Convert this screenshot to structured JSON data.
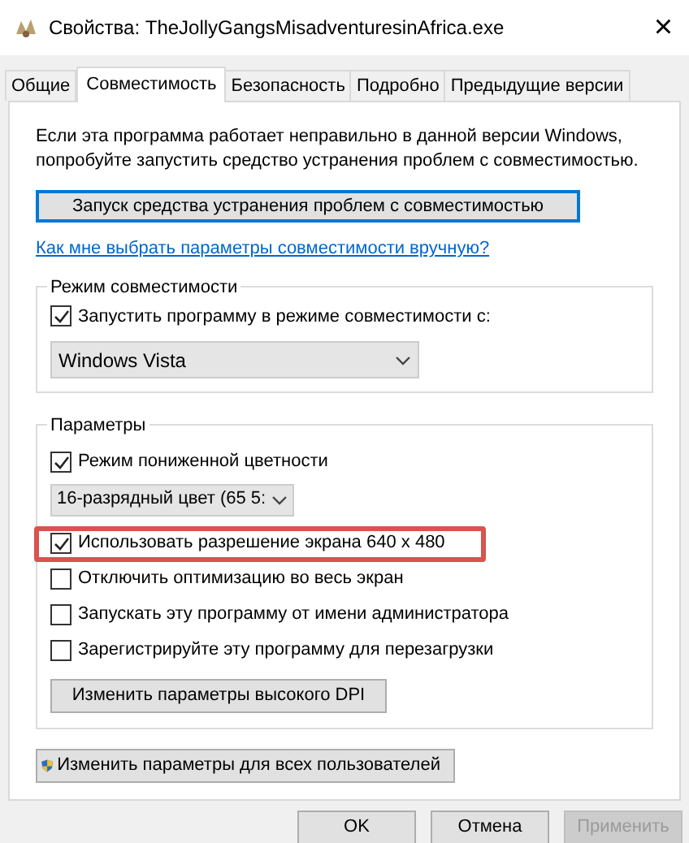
{
  "window": {
    "title": "Свойства: TheJollyGangsMisadventuresinAfrica.exe",
    "close": "×"
  },
  "tabs": [
    {
      "label": "Общие",
      "selected": false
    },
    {
      "label": "Совместимость",
      "selected": true
    },
    {
      "label": "Безопасность",
      "selected": false
    },
    {
      "label": "Подробно",
      "selected": false
    },
    {
      "label": "Предыдущие версии",
      "selected": false
    }
  ],
  "intro": "Если эта программа работает неправильно в данной версии Windows, попробуйте запустить средство устранения проблем с совместимостью.",
  "troubleshoot_button": "Запуск средства устранения проблем с совместимостью",
  "help_link": "Как мне выбрать параметры совместимости вручную?",
  "compat_group": {
    "title": "Режим совместимости",
    "checkbox": {
      "label": "Запустить программу в режиме совместимости с:",
      "checked": true
    },
    "dropdown": "Windows Vista"
  },
  "params_group": {
    "title": "Параметры",
    "items": [
      {
        "kind": "checkbox",
        "label": "Режим пониженной цветности",
        "checked": true,
        "highlighted": false
      },
      {
        "kind": "dropdown",
        "value": "16-разрядный цвет (65 5:"
      },
      {
        "kind": "checkbox",
        "label": "Использовать разрешение экрана 640 x 480",
        "checked": true,
        "highlighted": true
      },
      {
        "kind": "checkbox",
        "label": "Отключить оптимизацию во весь экран",
        "checked": false,
        "highlighted": false
      },
      {
        "kind": "checkbox",
        "label": "Запускать эту программу от имени администратора",
        "checked": false,
        "highlighted": false
      },
      {
        "kind": "checkbox",
        "label": "Зарегистрируйте эту программу для перезагрузки",
        "checked": false,
        "highlighted": false
      },
      {
        "kind": "button",
        "label": "Изменить параметры высокого DPI"
      }
    ]
  },
  "all_users_button": "Изменить параметры для всех пользователей",
  "buttons": [
    {
      "label": "OK",
      "disabled": false
    },
    {
      "label": "Отмена",
      "disabled": false
    },
    {
      "label": "Применить",
      "disabled": true
    }
  ]
}
